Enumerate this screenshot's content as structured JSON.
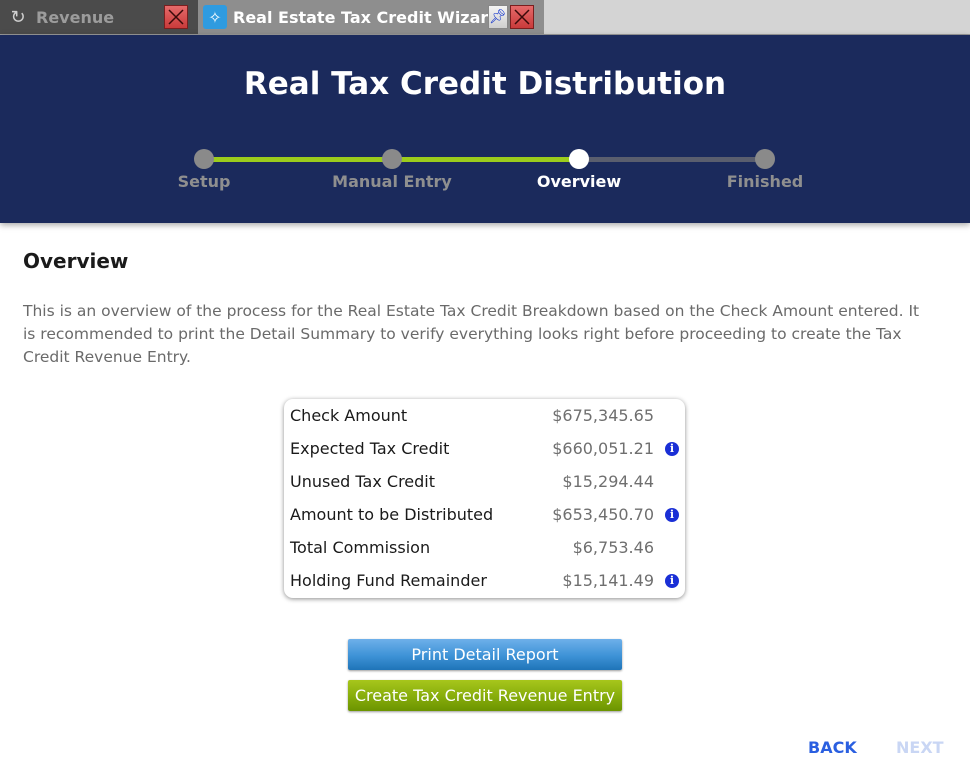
{
  "tabs": [
    {
      "label": "Revenue",
      "icon": "money-cycle-icon",
      "active": false
    },
    {
      "label": "Real Estate Tax Credit Wizard",
      "icon": "magic-wand-icon",
      "active": true
    }
  ],
  "header": {
    "title": "Real Tax Credit Distribution"
  },
  "stepper": {
    "steps": [
      {
        "label": "Setup",
        "state": "completed"
      },
      {
        "label": "Manual Entry",
        "state": "completed"
      },
      {
        "label": "Overview",
        "state": "current"
      },
      {
        "label": "Finished",
        "state": "pending"
      }
    ],
    "colors": {
      "completed_track": "#9ccc1c",
      "pending_track": "#5a5e6e",
      "dot_inactive": "#8a8a8a",
      "dot_current": "#ffffff"
    }
  },
  "content": {
    "title": "Overview",
    "intro": "This is an overview of the process for the Real Estate Tax Credit Breakdown based on the Check Amount entered.  It is recommended to print the Detail Summary to verify everything looks right before proceeding to create the Tax Credit Revenue Entry."
  },
  "summary": {
    "rows": [
      {
        "label": "Check Amount",
        "value": "$675,345.65",
        "info": false
      },
      {
        "label": "Expected Tax Credit",
        "value": "$660,051.21",
        "info": true
      },
      {
        "label": "Unused Tax Credit",
        "value": "$15,294.44",
        "info": false
      },
      {
        "label": "Amount to be Distributed",
        "value": "$653,450.70",
        "info": true
      },
      {
        "label": "Total Commission",
        "value": "$6,753.46",
        "info": false
      },
      {
        "label": "Holding Fund Remainder",
        "value": "$15,141.49",
        "info": true
      }
    ],
    "info_glyph": "i"
  },
  "actions": {
    "print_label": "Print Detail Report",
    "create_label": "Create Tax Credit Revenue Entry"
  },
  "nav": {
    "back_label": "BACK",
    "next_label": "NEXT",
    "next_enabled": false
  }
}
